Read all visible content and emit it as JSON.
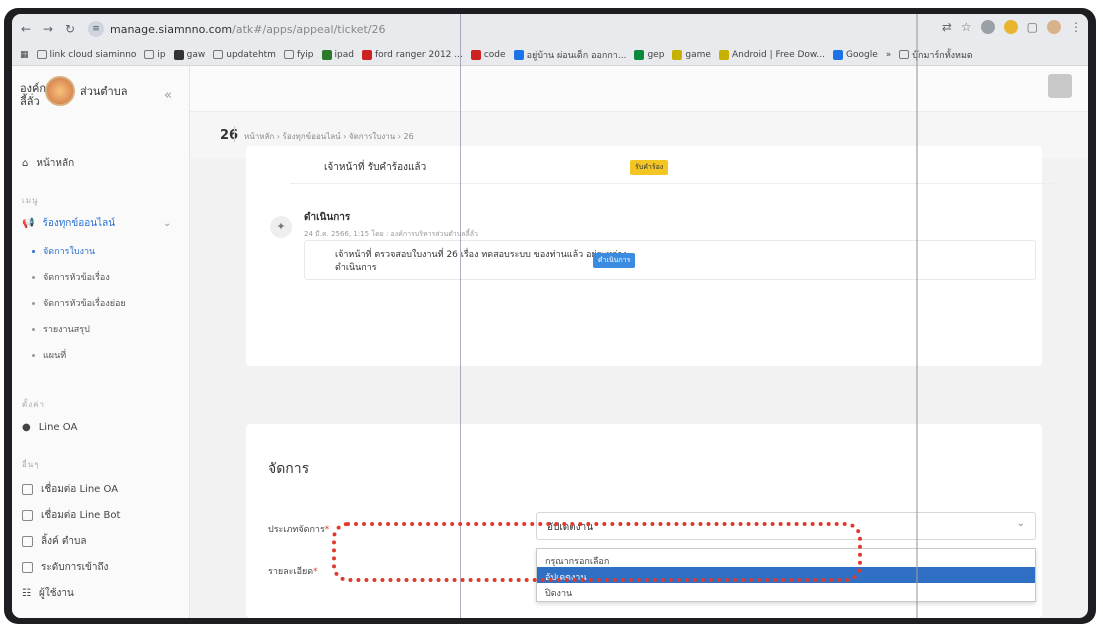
{
  "browser": {
    "url_host": "manage.siamnno.com",
    "url_path": "/atk#/apps/appeal/ticket/26",
    "bookmarks": [
      {
        "label": "link cloud siaminno",
        "color": "#777"
      },
      {
        "label": "ip",
        "color": "#777"
      },
      {
        "label": "gaw",
        "color": "#333"
      },
      {
        "label": "updatehtm",
        "color": "#777"
      },
      {
        "label": "fyip",
        "color": "#777"
      },
      {
        "label": "ipad",
        "color": "#2a7a2a"
      },
      {
        "label": "ford ranger 2012 ...",
        "color": "#c22"
      },
      {
        "label": "code",
        "color": "#c22"
      },
      {
        "label": "อยู่บ้าน ผ่อนเด็ก ออกกา...",
        "color": "#1a73e8"
      },
      {
        "label": "gep",
        "color": "#0a8a3a"
      },
      {
        "label": "game",
        "color": "#c7b100"
      },
      {
        "label": "Android | Free Dow...",
        "color": "#c7b100"
      },
      {
        "label": "Google",
        "color": "#1a73e8"
      },
      {
        "label": "บุ๊กมาร์กทั้งหมด",
        "color": "#777"
      }
    ]
  },
  "sidebar": {
    "org_name_1": "องค์การ",
    "org_name_2": "ส่วนตำบล",
    "org_name_3": "ลี้ลั่ว",
    "home": "หน้าหลัก",
    "section_menu": "เมนู",
    "complaints": "ร้องทุกข์ออนไลน์",
    "sub_items": [
      "จัดการใบงาน",
      "จัดการหัวข้อเรื่อง",
      "จัดการหัวข้อเรื่องย่อย",
      "รายงานสรุป",
      "แผนที่"
    ],
    "section_settings": "ตั้งค่า",
    "line_oa": "Line OA",
    "section_other": "อื่นๆ",
    "others": [
      "เชื่อมต่อ Line OA",
      "เชื่อมต่อ Line Bot",
      "ลิ้งค์ ตำบล",
      "ระดับการเข้าถึง",
      "ผู้ใช้งาน"
    ]
  },
  "breadcrumb": {
    "ticket_number": "26",
    "path": "หน้าหลัก  ›  ร้องทุกข์ออนไลน์  ›  จัดการใบงาน  ›  26"
  },
  "timeline": {
    "entry1_text": "เจ้าหน้าที่ รับคำร้องแล้ว",
    "entry1_badge": "รับคำร้อง",
    "entry1_badge_color": "#f3c623",
    "action_title": "ดำเนินการ",
    "action_meta": "24 มี.ค. 2566, 1:15 โดย : องค์การบริหารส่วนตำบลลี้ลั่ว",
    "action_body": "เจ้าหน้าที่ ตรวจสอบใบงานที่ 26 เรื่อง ทดสอบระบบ ของท่านแล้ว อยู่ระหว่างดำเนินการ",
    "action_badge": "ดำเนินการ",
    "action_badge_color": "#3b8be0"
  },
  "manage": {
    "title": "จัดการ",
    "type_label": "ประเภทจัดการ",
    "detail_label": "รายละเอียด",
    "selected_value": "อัปเดตงาน",
    "options": [
      "กรุณากรอกเลือก",
      "อัปเดตงาน",
      "ปิดงาน"
    ],
    "selected_index": 1
  }
}
